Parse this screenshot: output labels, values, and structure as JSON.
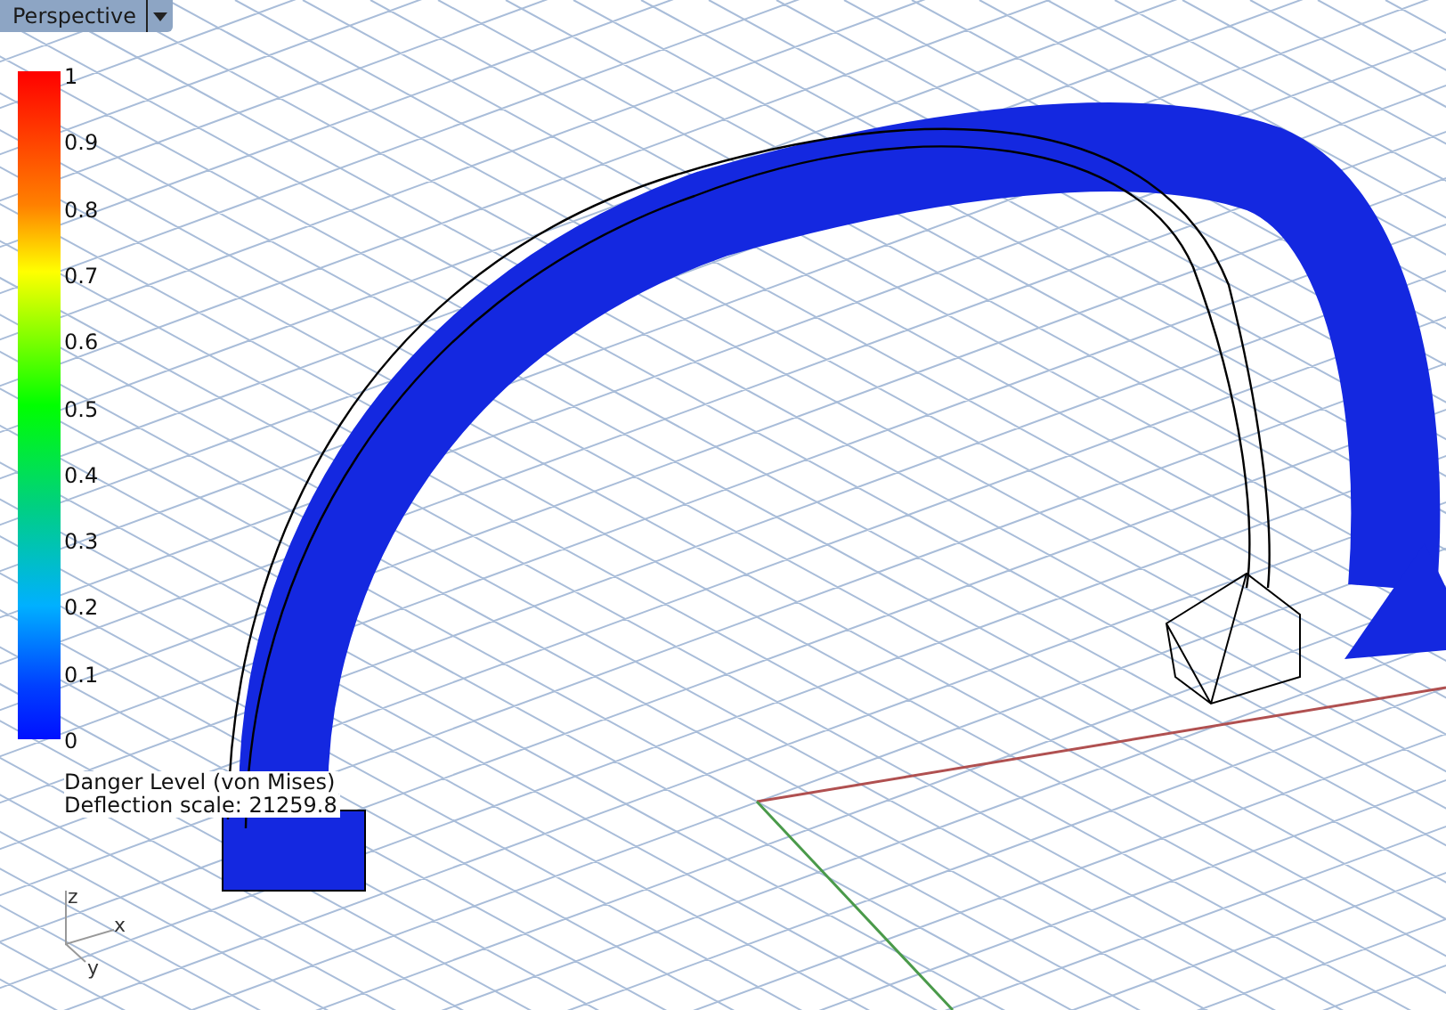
{
  "viewport": {
    "tab": {
      "label": "Perspective"
    }
  },
  "legend": {
    "ticks": [
      "1",
      "0.9",
      "0.8",
      "0.7",
      "0.6",
      "0.5",
      "0.4",
      "0.3",
      "0.2",
      "0.1",
      "0"
    ]
  },
  "legend_title": "Danger Level (von Mises)",
  "deflection": "Deflection scale: 21259.8",
  "axes": {
    "z": "z",
    "x": "x",
    "y": "y"
  }
}
